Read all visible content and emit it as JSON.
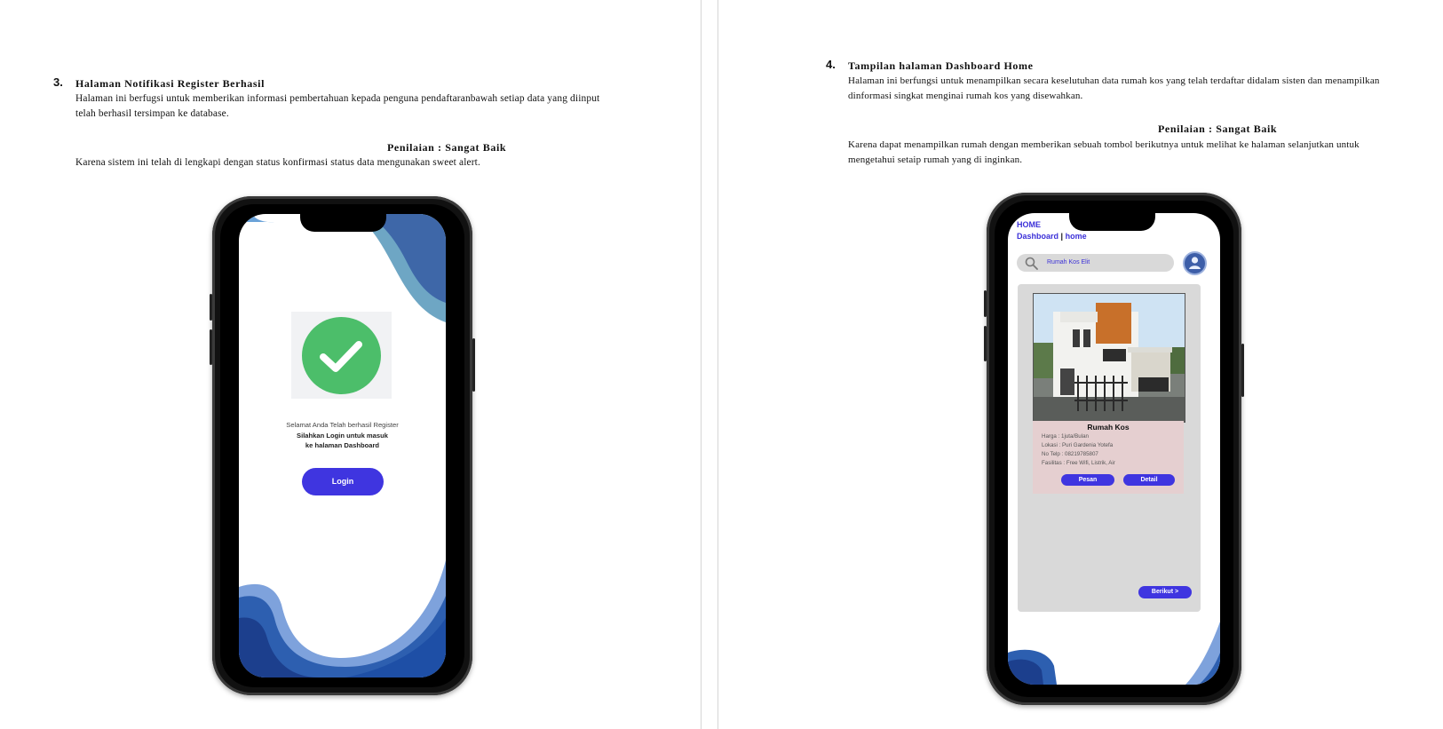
{
  "left_section": {
    "number": "3.",
    "title": "Halaman Notifikasi Register Berhasil",
    "para1_line1": "Halaman ini berfugsi untuk memberikan informasi pembertahuan kepada penguna pendaftaranbawah setiap data yang diinput",
    "para1_line2": "telah berhasil tersimpan ke database.",
    "rating": "Penilaian : Sangat Baik",
    "para2": "Karena sistem ini telah di lengkapi dengan status konfirmasi status data mengunakan sweet alert."
  },
  "right_section": {
    "number": "4.",
    "title": "Tampilan halaman Dashboard Home",
    "para1_line1": "Halaman ini berfungsi untuk menampilkan secara keselutuhan data rumah kos yang telah terdaftar didalam sisten dan menampilkan",
    "para1_line2": "dinformasi singkat menginai rumah kos yang disewahkan.",
    "rating": "Penilaian : Sangat Baik",
    "para2_line1": "Karena dapat menampilkan rumah dengan memberikan sebuah tombol berikutnya untuk melihat ke halaman selanjutkan untuk",
    "para2_line2": "mengetahui setaip rumah yang di inginkan."
  },
  "phone_register": {
    "message_line1": "Selamat Anda Telah berhasil Register",
    "message_line2": "Silahkan Login untuk masuk",
    "message_line3": "ke halaman Dashboard",
    "login_button": "Login",
    "icons": [
      "check-icon"
    ],
    "colors": {
      "accent": "#3f35e0",
      "success": "#4cbe6a",
      "wave": "#2d5fb0"
    }
  },
  "phone_dashboard": {
    "header_title": "HOME",
    "breadcrumb_left": "Dashboard",
    "breadcrumb_sep": "|",
    "breadcrumb_right": "home",
    "search_value": "Rumah Kos Elit",
    "card_title": "Rumah Kos",
    "card_lines": [
      "Harga : 1juta/Bulan",
      "Lokasi : Puri Gardenia Yotefa",
      "No Telp : 08219785807",
      "Fasilitas : Free Wifi, Listrik, Air"
    ],
    "order_button": "Pesan",
    "detail_button": "Detail",
    "next_button": "Berikut >",
    "icons": [
      "search-icon",
      "user-icon"
    ],
    "colors": {
      "accent": "#3f35e0",
      "panel": "#d9d9d9",
      "card": "#e5cfd0"
    }
  }
}
